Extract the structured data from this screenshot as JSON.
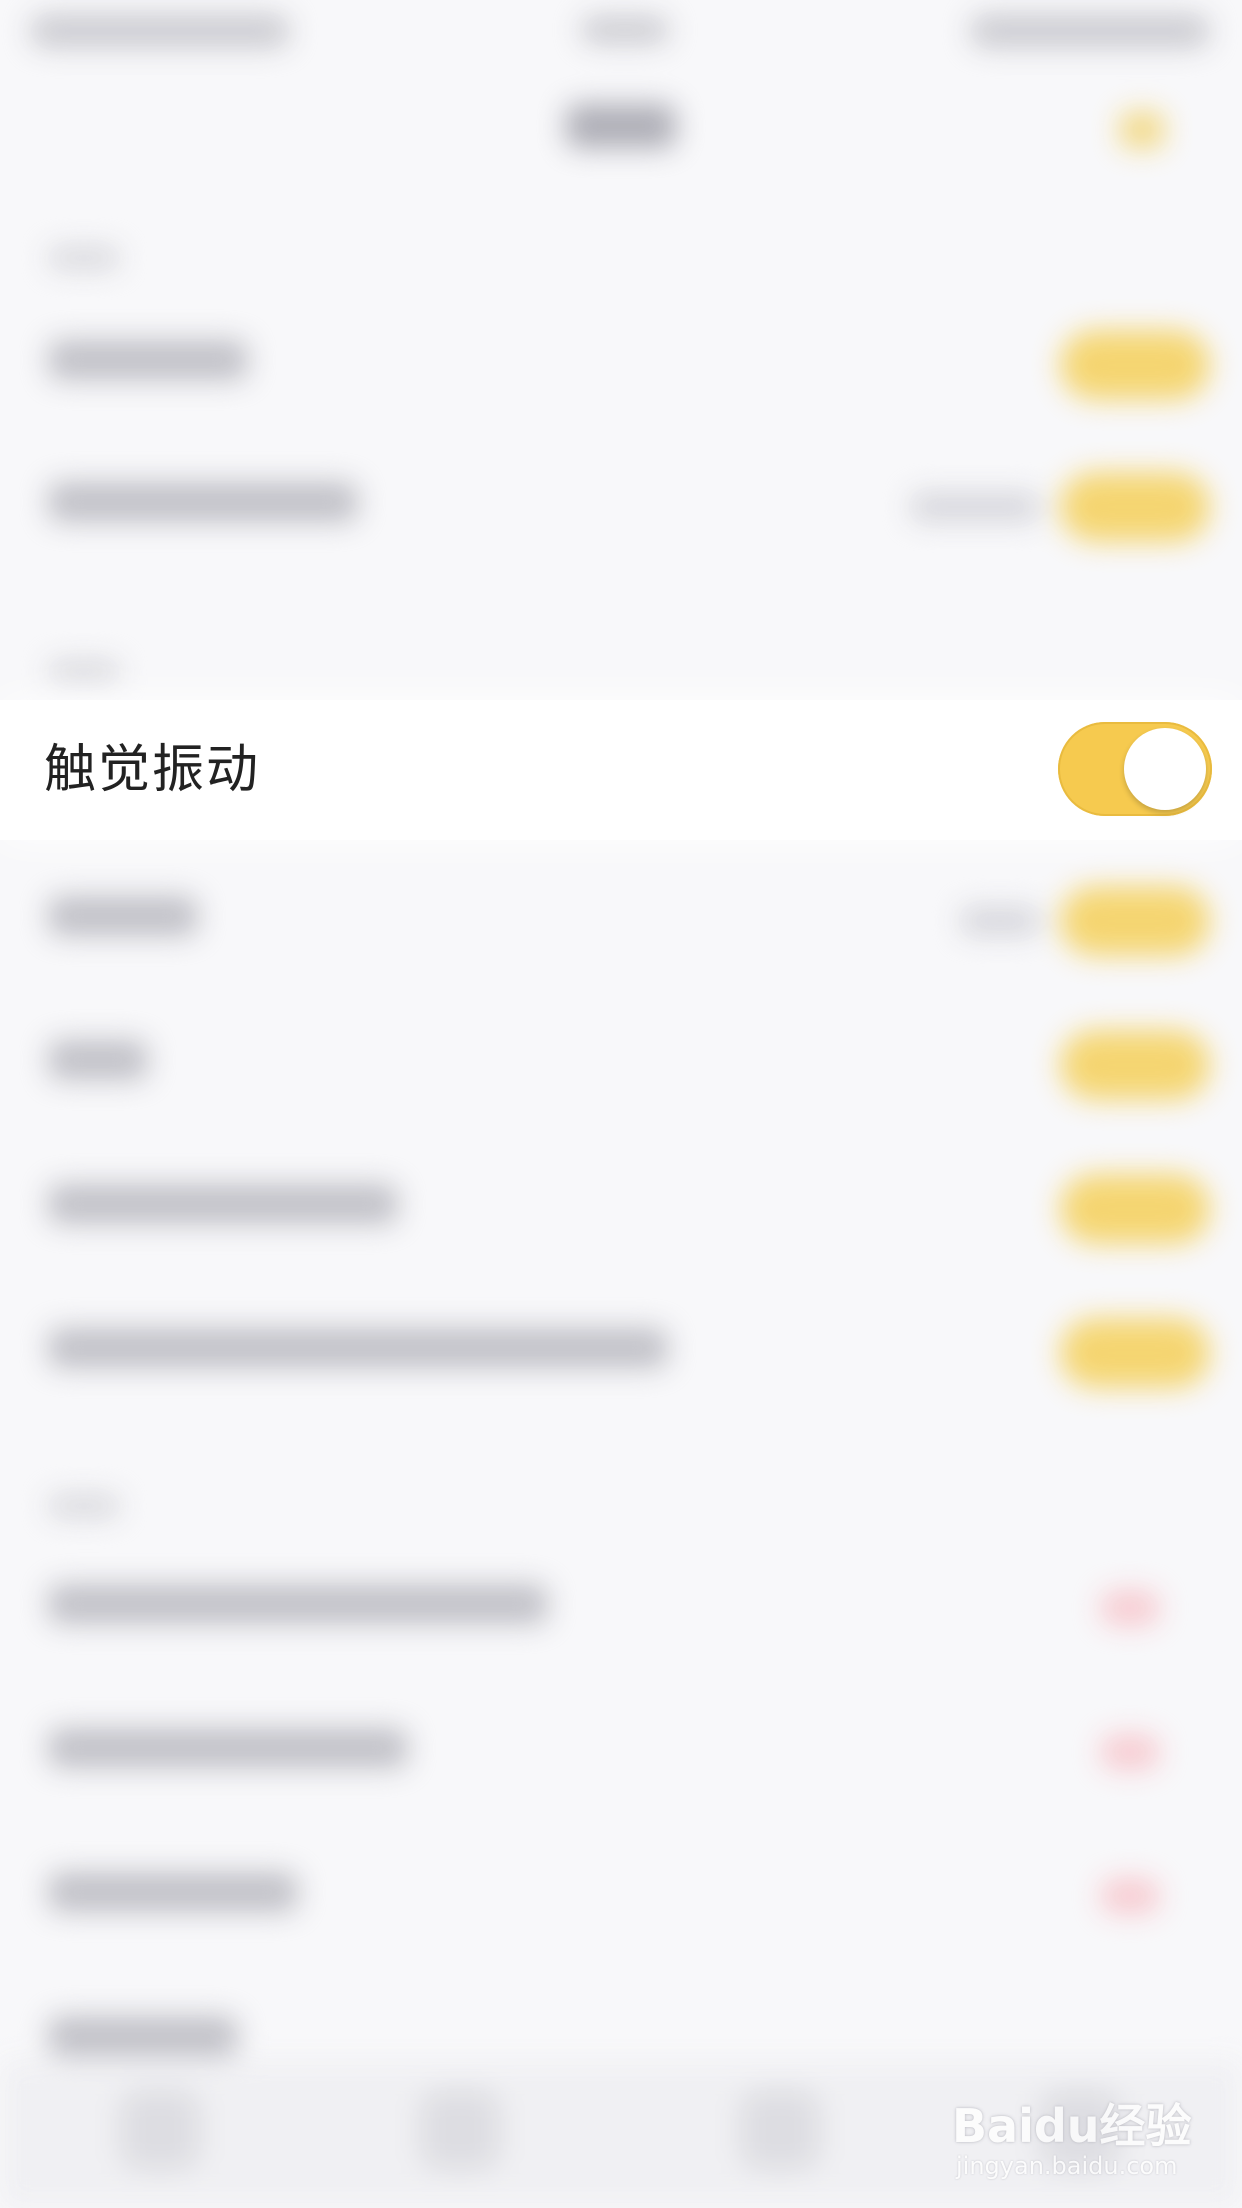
{
  "focused_setting": {
    "label": "触觉振动",
    "toggle_on": true
  },
  "colors": {
    "accent": "#f6ca4f",
    "background": "#f8f8fa",
    "text": "#222222"
  },
  "watermark": {
    "brand": "Baidu经验",
    "url": "jingyan.baidu.com"
  }
}
